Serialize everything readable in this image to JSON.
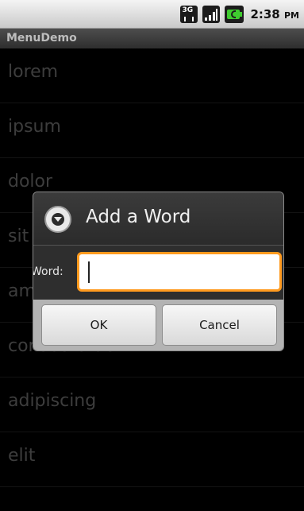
{
  "status_bar": {
    "network": "3G",
    "time": "2:38",
    "ampm": "PM",
    "battery_color": "#3fcc2f"
  },
  "app": {
    "title": "MenuDemo"
  },
  "list": {
    "items": [
      {
        "label": "lorem"
      },
      {
        "label": "ipsum"
      },
      {
        "label": "dolor"
      },
      {
        "label": "sit"
      },
      {
        "label": "amet"
      },
      {
        "label": "consectetuer"
      },
      {
        "label": "adipiscing"
      },
      {
        "label": "elit"
      }
    ]
  },
  "dialog": {
    "title": "Add a Word",
    "icon": "chevron-down-circle-icon",
    "field_label": "Word:",
    "field_value": "",
    "accent_color": "#ff9a1e",
    "ok_label": "OK",
    "cancel_label": "Cancel"
  }
}
